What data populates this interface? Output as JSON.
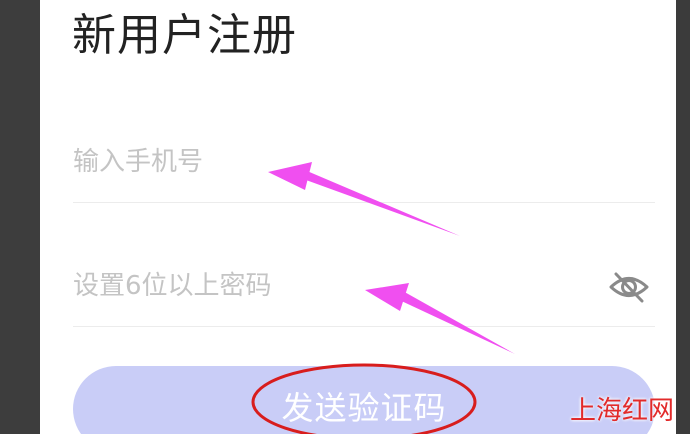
{
  "register": {
    "title": "新用户注册",
    "phone_placeholder": "输入手机号",
    "password_placeholder": "设置6位以上密码",
    "send_code_label": "发送验证码"
  },
  "icons": {
    "password_toggle": "eye-off-icon"
  },
  "annotations": {
    "arrow_color": "#f04ff0",
    "circle_color": "#d81d1d"
  },
  "watermark": {
    "text": "上海红网",
    "color": "#e22b2b"
  }
}
